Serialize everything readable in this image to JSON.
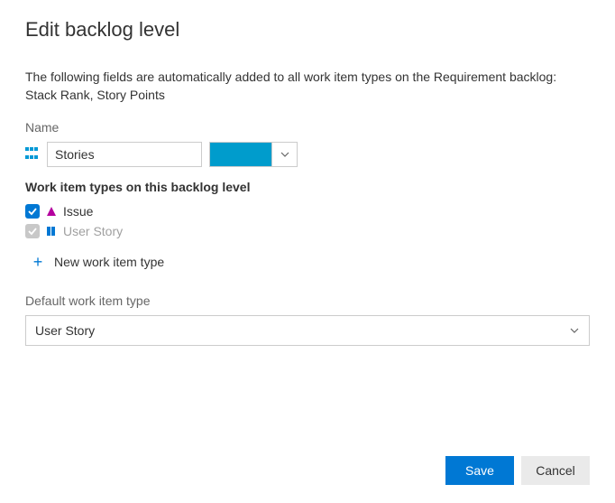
{
  "title": "Edit backlog level",
  "description": "The following fields are automatically added to all work item types on the Requirement backlog: Stack Rank, Story Points",
  "name_label": "Name",
  "name_value": "Stories",
  "color_value": "#009CCC",
  "wit_section_label": "Work item types on this backlog level",
  "wits": [
    {
      "name": "Issue",
      "checked": true,
      "disabled": false,
      "icon": "triangle",
      "icon_color": "#b4009e"
    },
    {
      "name": "User Story",
      "checked": true,
      "disabled": true,
      "icon": "book",
      "icon_color": "#0078d4"
    }
  ],
  "new_wit_label": "New work item type",
  "default_label": "Default work item type",
  "default_value": "User Story",
  "buttons": {
    "save": "Save",
    "cancel": "Cancel"
  }
}
